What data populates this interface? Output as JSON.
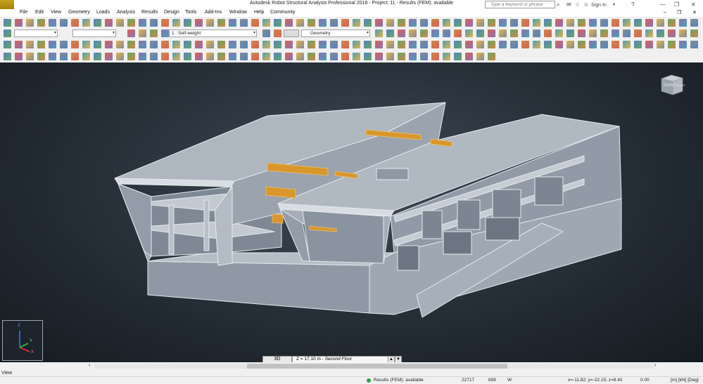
{
  "window": {
    "title": "Autodesk Robot Structural Analysis Professional 2018 - Project: 11 - Results (FEM): available",
    "app_icon_label": "PRO",
    "search_placeholder": "Type a keyword or phrase",
    "sign_in": "Sign In"
  },
  "menu": [
    "File",
    "Edit",
    "View",
    "Geometry",
    "Loads",
    "Analysis",
    "Results",
    "Design",
    "Tools",
    "Add-Ins",
    "Window",
    "Help",
    "Community"
  ],
  "toolbar": {
    "load_case": "1 : Self-weight",
    "layout": "Geometry"
  },
  "viewport": {
    "view_mode": "3D",
    "level_value": "Z = 17.10 m",
    "level_name": "Second Floor",
    "viewcube_front": "FRONT",
    "viewcube_right": "RIGHT",
    "axis_x": "X",
    "axis_y": "Y",
    "axis_z": "Z"
  },
  "view_tab": "View",
  "status": {
    "results": "Results (FEM): available",
    "node_count": "22717",
    "field2": "699",
    "field3": "W",
    "coords": "x=-11.82; y=-22.15; z=8.40",
    "angle": "0.00",
    "units": "[m] [kN] [Deg]"
  },
  "colors": {
    "viewport_bg": "#2a323a",
    "panel_fill": "#a4adb8",
    "panel_edge": "#e8ecef",
    "beam": "#d9962a",
    "status_ok": "#2ea043"
  }
}
